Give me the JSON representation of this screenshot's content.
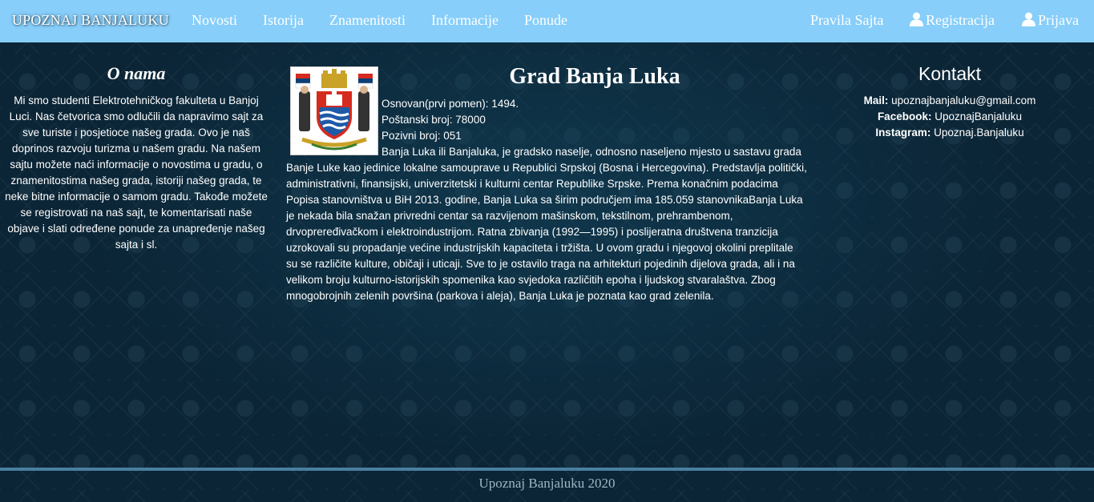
{
  "nav": {
    "brand": "UPOZNAJ BANJALUKU",
    "links": [
      "Novosti",
      "Istorija",
      "Znamenitosti",
      "Informacije",
      "Ponude"
    ],
    "right": {
      "rules": "Pravila Sajta",
      "register": "Registracija",
      "login": "Prijava"
    }
  },
  "about": {
    "title": "O nama",
    "text": "Mi smo studenti Elektrotehničkog fakulteta u Banjoj Luci. Nas četvorica smo odlučili da napravimo sajt za sve turiste i posjetioce našeg grada. Ovo je naš doprinos razvoju turizma u našem gradu. Na našem sajtu možete naći informacije o novostima u gradu, o znamenitostima našeg grada, istoriji našeg grada, te neke bitne informacije o samom gradu. Takođe možete se registrovati na naš sajt, te komentarisati naše objave i slati određene ponude za unapređenje našeg sajta i sl."
  },
  "main": {
    "title": "Grad Banja Luka",
    "facts": [
      "Osnovan(prvi pomen): 1494.",
      "Poštanski broj: 78000",
      "Pozivni broj: 051"
    ],
    "description": "Banja Luka ili Banjaluka, je gradsko naselje, odnosno naseljeno mjesto u sastavu grada Banje Luke kao jedinice lokalne samouprave u Republici Srpskoj (Bosna i Hercegovina). Predstavlja politički, administrativni, finansijski, univerzitetski i kulturni centar Republike Srpske. Prema konačnim podacima Popisa stanovništva u BiH 2013. godine, Banja Luka sa širim područjem ima 185.059 stanovnikaBanja Luka je nekada bila snažan privredni centar sa razvijenom mašinskom, tekstilnom, prehrambenom, drvopreređivačkom i elektroindustrijom. Ratna zbivanja (1992—1995) i poslijeratna društvena tranzicija uzrokovali su propadanje većine industrijskih kapaciteta i tržišta. U ovom gradu i njegovoj okolini preplitale su se različite kulture, običaji i uticaji. Sve to je ostavilo traga na arhitekturi pojedinih dijelova grada, ali i na velikom broju kulturno-istorijskih spomenika kao svjedoka različitih epoha i ljudskog stvaralaštva. Zbog mnogobrojnih zelenih površina (parkova i aleja), Banja Luka je poznata kao grad zelenila."
  },
  "contact": {
    "title": "Kontakt",
    "rows": [
      {
        "label": "Mail:",
        "value": "upoznajbanjaluku@gmail.com"
      },
      {
        "label": "Facebook:",
        "value": "UpoznajBanjaluku"
      },
      {
        "label": "Instagram:",
        "value": "Upoznaj.Banjaluku"
      }
    ]
  },
  "footer": {
    "text": "Upoznaj Banjaluku 2020"
  },
  "colors": {
    "navbar": "#87cefa",
    "background": "#0b2536",
    "footer_line": "#4a7f9e"
  },
  "icons": {
    "user": "user-icon",
    "crest": "coat-of-arms"
  }
}
